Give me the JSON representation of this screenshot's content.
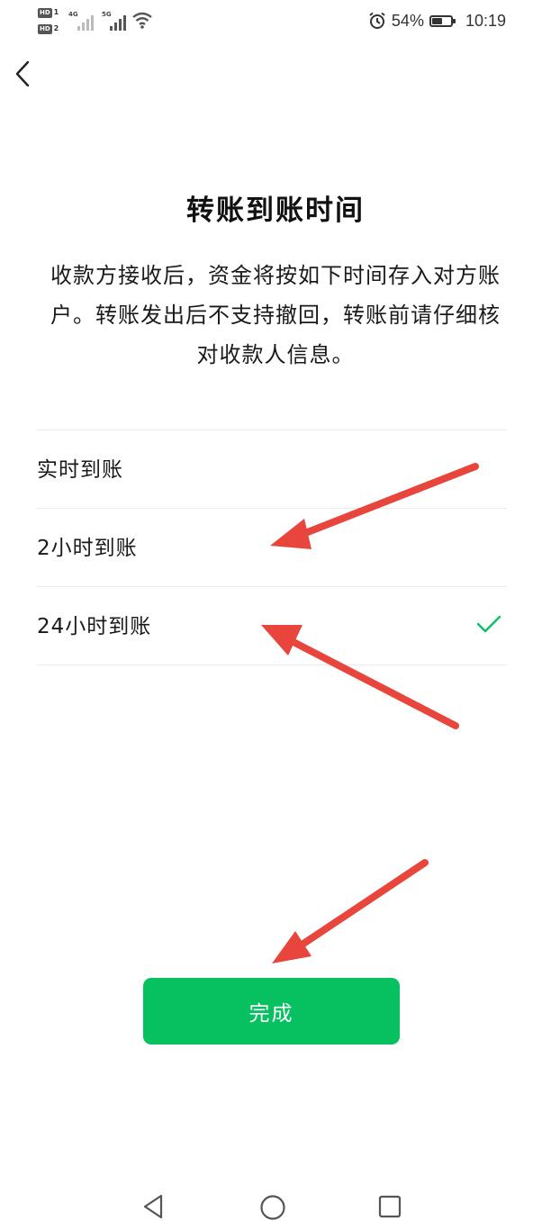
{
  "status_bar": {
    "sim1_label": "HD",
    "sim1_num": "1",
    "sim2_label": "HD",
    "sim2_num": "2",
    "net1": "4G",
    "net2": "5G",
    "battery_percent": "54%",
    "battery_level": 0.54,
    "time": "10:19",
    "icons": [
      "signal-icon",
      "wifi-icon",
      "alarm-icon",
      "battery-icon"
    ]
  },
  "header": {
    "back_icon": "chevron-left-icon"
  },
  "main": {
    "title": "转账到账时间",
    "description": "收款方接收后，资金将按如下时间存入对方账户。转账发出后不支持撤回，转账前请仔细核对收款人信息。",
    "options": [
      {
        "label": "实时到账",
        "selected": false
      },
      {
        "label": "2小时到账",
        "selected": false
      },
      {
        "label": "24小时到账",
        "selected": true
      }
    ],
    "done_label": "完成"
  },
  "colors": {
    "accent": "#07c160",
    "annotation_arrow": "#e8453c",
    "divider": "#ebebeb"
  },
  "nav_bar": {
    "icons": [
      "nav-back-icon",
      "nav-home-icon",
      "nav-recents-icon"
    ]
  }
}
